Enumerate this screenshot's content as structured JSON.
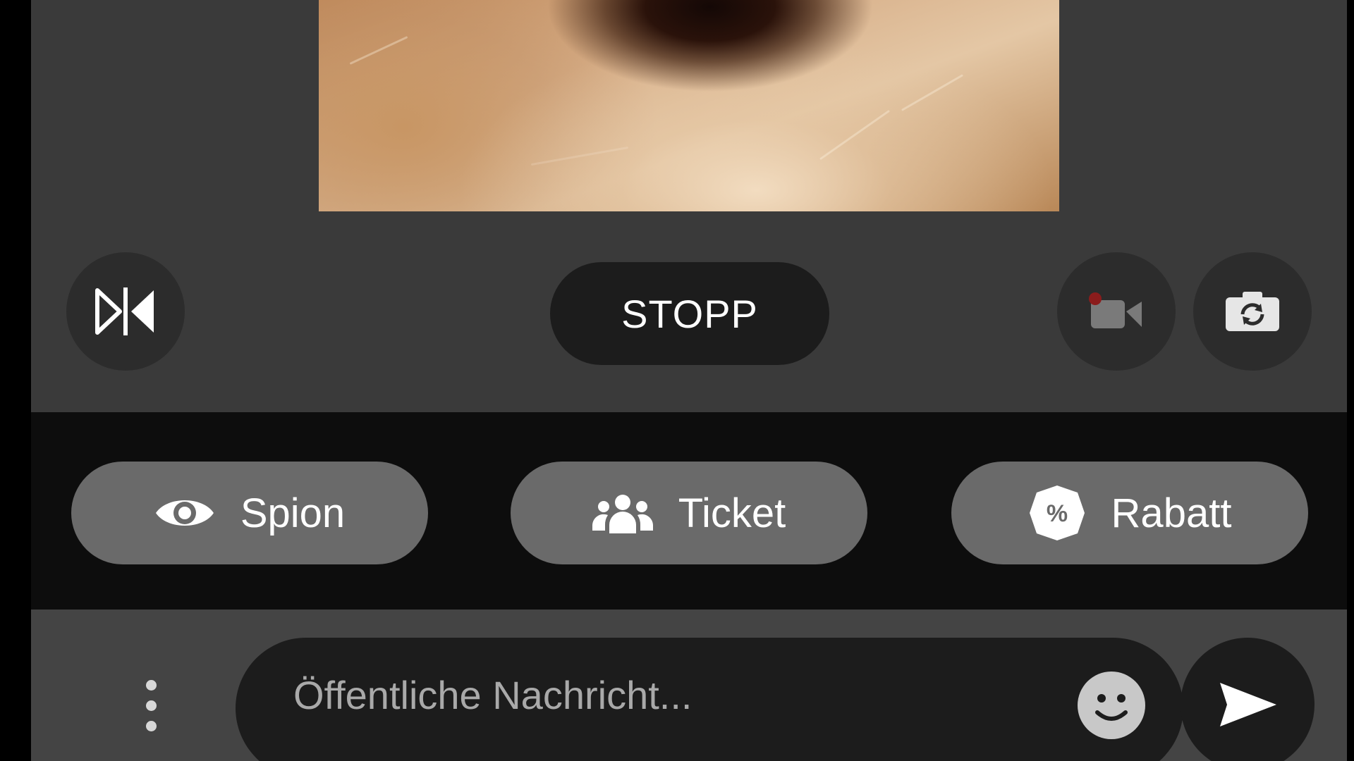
{
  "app": {
    "background": "#3a3a3a",
    "accent_record": "#8b1c1c"
  },
  "video": {
    "description_icon": "camera-preview"
  },
  "controls": {
    "mirror_icon": "flip-horizontal-icon",
    "stop_label": "STOPP",
    "record_icon": "video-record-icon",
    "switch_camera_icon": "camera-switch-icon"
  },
  "actions": {
    "items": [
      {
        "label": "Spion",
        "icon": "eye-icon"
      },
      {
        "label": "Ticket",
        "icon": "group-icon"
      },
      {
        "label": "Rabatt",
        "icon": "percent-badge-icon"
      }
    ]
  },
  "message": {
    "placeholder": "Öffentliche Nachricht...",
    "value": "",
    "menu_icon": "more-vertical-icon",
    "emoji_icon": "smiley-icon",
    "send_icon": "send-icon"
  }
}
